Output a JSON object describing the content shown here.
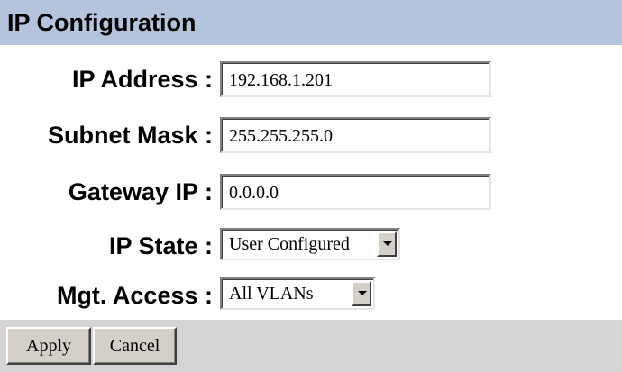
{
  "panel": {
    "title": "IP Configuration"
  },
  "fields": {
    "ip_address": {
      "label": "IP Address :",
      "value": "192.168.1.201"
    },
    "subnet_mask": {
      "label": "Subnet Mask :",
      "value": "255.255.255.0"
    },
    "gateway_ip": {
      "label": "Gateway IP :",
      "value": "0.0.0.0"
    },
    "ip_state": {
      "label": "IP State :",
      "selected": "User Configured"
    },
    "mgt_access": {
      "label": "Mgt. Access :",
      "selected": "All VLANs"
    }
  },
  "actions": {
    "apply_label": "Apply",
    "cancel_label": "Cancel"
  },
  "colors": {
    "title_bar": "#b4c4dc",
    "footer": "#d4d4d4",
    "button_face": "#d4d0c8"
  },
  "icons": {
    "dropdown": "chevron-down-icon"
  }
}
